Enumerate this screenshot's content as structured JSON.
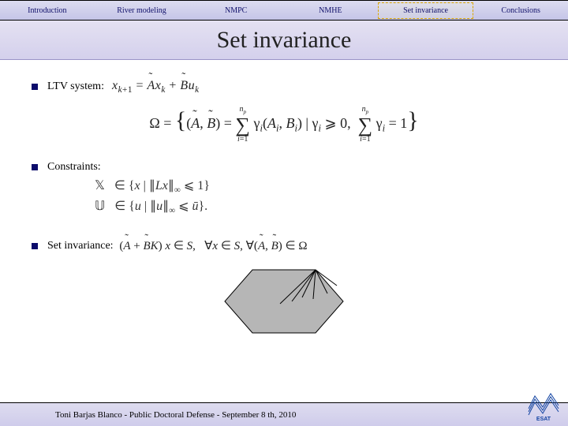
{
  "nav": {
    "items": [
      {
        "label": "Introduction"
      },
      {
        "label": "River modeling"
      },
      {
        "label": "NMPC"
      },
      {
        "label": "NMHE"
      },
      {
        "label": "Set invariance"
      },
      {
        "label": "Conclusions"
      }
    ],
    "active_index": 4
  },
  "title": "Set invariance",
  "bullets": {
    "ltv": "LTV system:",
    "constraints": "Constraints:",
    "setinv": "Set invariance:"
  },
  "math": {
    "ltv_eq": "x_{k+1} = Ã x_k + B̃ u_k",
    "omega_eq": "Ω = { (Ã, B̃) = Σ_{i=1}^{n_p} γ_i (A_i, B_i) | γ_i ≥ 0,  Σ_{i=1}^{n_p} γ_i = 1 }",
    "constraint_x": "𝕏  ∈ { x | ∥Lx∥_∞ ≤ 1 }",
    "constraint_u": "𝕌  ∈ { u | ∥u∥_∞ ≤ ū }.",
    "setinv_eq": "(Ã + B̃K) x ∈ S,   ∀x ∈ S, ∀(Ã, B̃) ∈ Ω"
  },
  "footer": "Toni Barjas Blanco - Public Doctoral Defense - September 8 th, 2010",
  "logo_text": "ESAT"
}
